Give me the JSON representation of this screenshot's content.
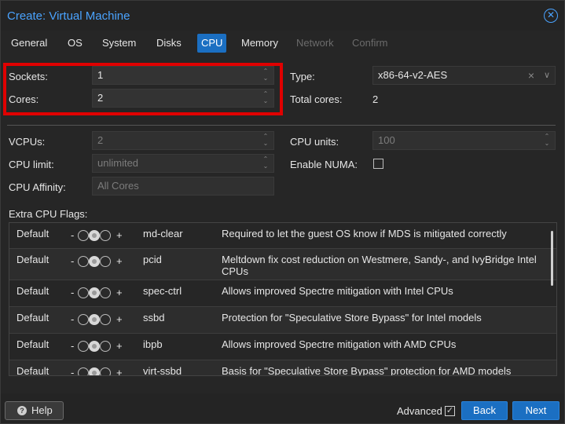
{
  "window": {
    "title": "Create: Virtual Machine"
  },
  "tabs": [
    {
      "label": "General"
    },
    {
      "label": "OS"
    },
    {
      "label": "System"
    },
    {
      "label": "Disks"
    },
    {
      "label": "CPU",
      "active": true
    },
    {
      "label": "Memory"
    },
    {
      "label": "Network",
      "disabled": true
    },
    {
      "label": "Confirm",
      "disabled": true
    }
  ],
  "form": {
    "sockets_label": "Sockets:",
    "sockets_value": "1",
    "cores_label": "Cores:",
    "cores_value": "2",
    "type_label": "Type:",
    "type_value": "x86-64-v2-AES",
    "total_cores_label": "Total cores:",
    "total_cores_value": "2",
    "vcpus_label": "VCPUs:",
    "vcpus_value": "2",
    "cpu_units_label": "CPU units:",
    "cpu_units_value": "100",
    "cpu_limit_label": "CPU limit:",
    "cpu_limit_value": "unlimited",
    "numa_label": "Enable NUMA:",
    "affinity_label": "CPU Affinity:",
    "affinity_placeholder": "All Cores",
    "extra_flags_label": "Extra CPU Flags:"
  },
  "flags": [
    {
      "state": "Default",
      "name": "md-clear",
      "desc": "Required to let the guest OS know if MDS is mitigated correctly"
    },
    {
      "state": "Default",
      "name": "pcid",
      "desc": "Meltdown fix cost reduction on Westmere, Sandy-, and IvyBridge Intel CPUs"
    },
    {
      "state": "Default",
      "name": "spec-ctrl",
      "desc": "Allows improved Spectre mitigation with Intel CPUs"
    },
    {
      "state": "Default",
      "name": "ssbd",
      "desc": "Protection for \"Speculative Store Bypass\" for Intel models"
    },
    {
      "state": "Default",
      "name": "ibpb",
      "desc": "Allows improved Spectre mitigation with AMD CPUs"
    },
    {
      "state": "Default",
      "name": "virt-ssbd",
      "desc": "Basis for \"Speculative Store Bypass\" protection for AMD models"
    }
  ],
  "tri": {
    "minus": "-",
    "plus": "+"
  },
  "footer": {
    "help": "Help",
    "advanced": "Advanced",
    "back": "Back",
    "next": "Next"
  },
  "colors": {
    "accent": "#1b6fc2",
    "highlight": "#e00000",
    "title": "#4aa3ff"
  }
}
